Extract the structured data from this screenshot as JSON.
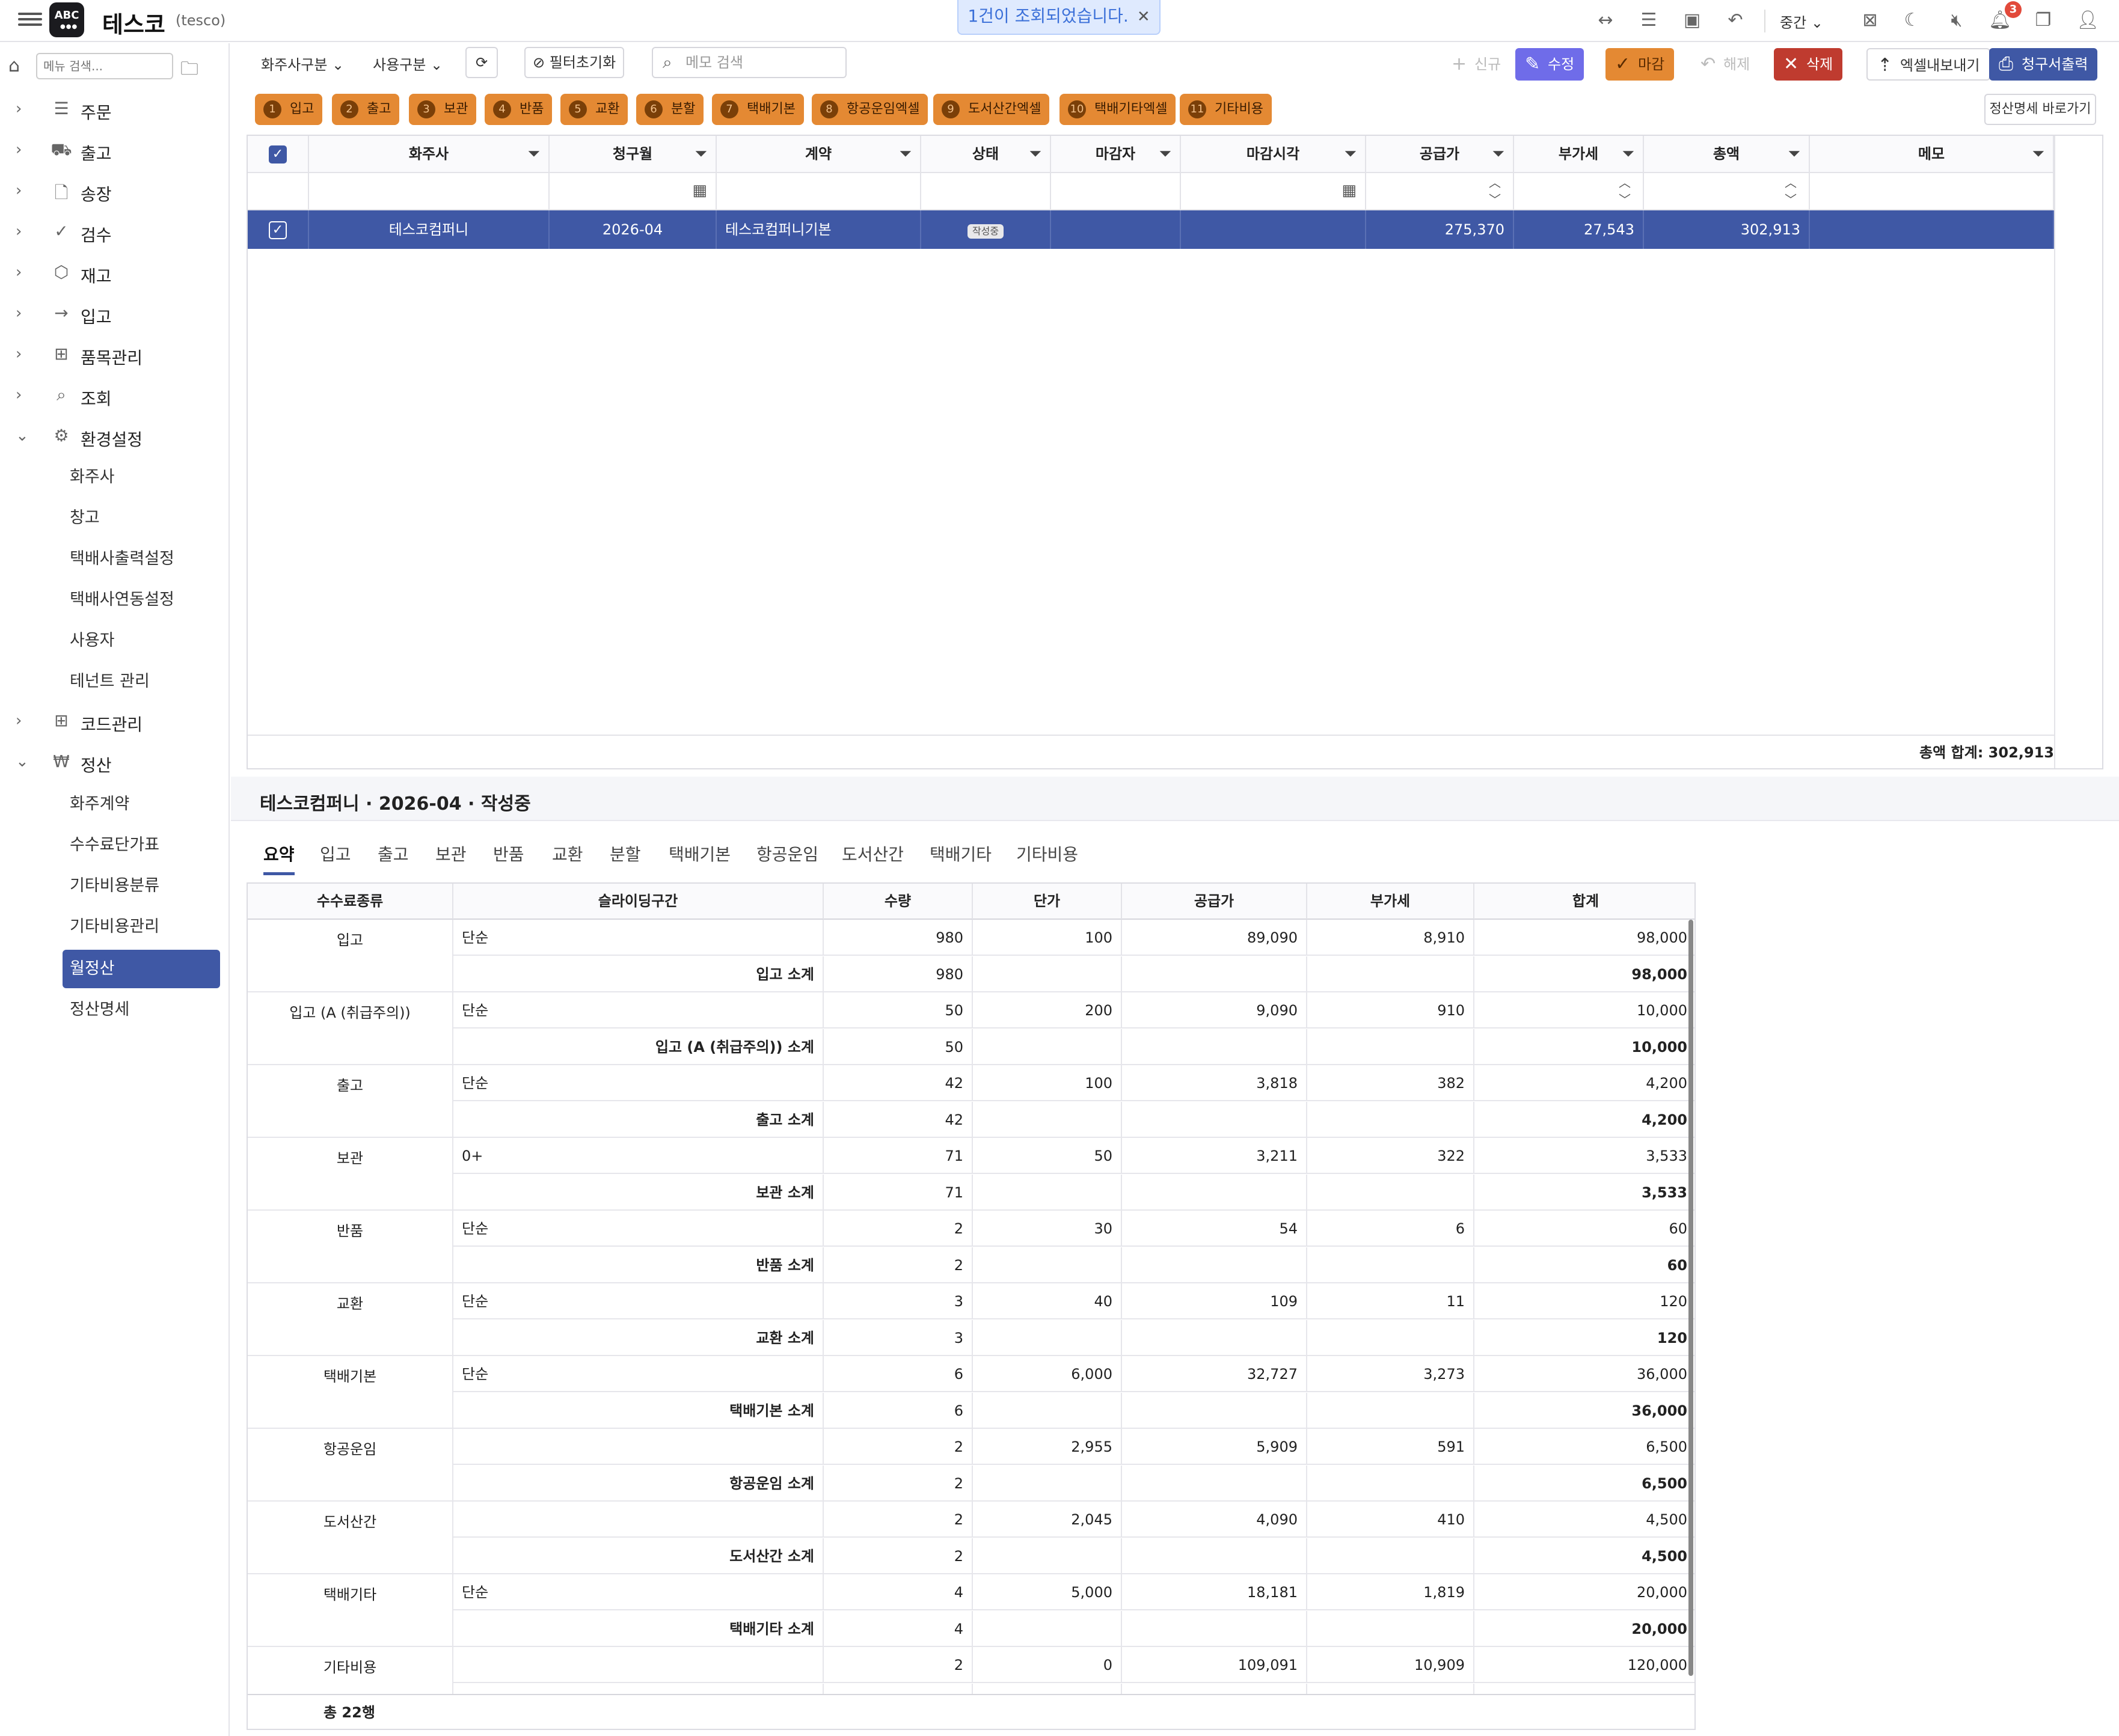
{
  "header": {
    "logo_text": "ABC",
    "app_title": "테스코",
    "app_sub": "(tesco)",
    "toast": "1건이 조회되었습니다.",
    "zoom": "중간",
    "notification_count": "3"
  },
  "sidebar": {
    "search_placeholder": "메뉴 검색...",
    "menu": [
      {
        "label": "주문",
        "icon": "list-icon"
      },
      {
        "label": "출고",
        "icon": "truck-icon"
      },
      {
        "label": "송장",
        "icon": "document-icon"
      },
      {
        "label": "검수",
        "icon": "check-icon"
      },
      {
        "label": "재고",
        "icon": "box-icon"
      },
      {
        "label": "입고",
        "icon": "arrow-right-icon"
      },
      {
        "label": "품목관리",
        "icon": "gift-icon"
      },
      {
        "label": "조회",
        "icon": "search-icon"
      },
      {
        "label": "환경설정",
        "icon": "gear-icon"
      }
    ],
    "settings_sub": [
      "화주사",
      "창고",
      "택배사출력설정",
      "택배사연동설정",
      "사용자",
      "테넌트 관리"
    ],
    "code_menu": {
      "label": "코드관리",
      "icon": "plus-square-icon"
    },
    "settle_menu": {
      "label": "정산",
      "icon": "won-icon"
    },
    "settle_sub": [
      "화주계약",
      "수수료단가표",
      "기타비용분류",
      "기타비용관리",
      "월정산",
      "정산명세"
    ]
  },
  "toolbar": {
    "shipper_type": "화주사구분",
    "use_type": "사용구분",
    "filter_reset": "필터초기화",
    "memo_search_placeholder": "메모 검색",
    "new": "신규",
    "edit": "수정",
    "close": "마감",
    "release": "해제",
    "delete": "삭제",
    "excel_export": "엑셀내보내기",
    "print_invoice": "청구서출력"
  },
  "chips": [
    {
      "num": "1",
      "label": "입고"
    },
    {
      "num": "2",
      "label": "출고"
    },
    {
      "num": "3",
      "label": "보관"
    },
    {
      "num": "4",
      "label": "반품"
    },
    {
      "num": "5",
      "label": "교환"
    },
    {
      "num": "6",
      "label": "분할"
    },
    {
      "num": "7",
      "label": "택배기본"
    },
    {
      "num": "8",
      "label": "항공운임엑셀"
    },
    {
      "num": "9",
      "label": "도서산간엑셀"
    },
    {
      "num": "10",
      "label": "택배기타엑셀"
    },
    {
      "num": "11",
      "label": "기타비용"
    }
  ],
  "goto_statement": "정산명세 바로가기",
  "grid": {
    "headers": [
      "화주사",
      "청구월",
      "계약",
      "상태",
      "마감자",
      "마감시각",
      "공급가",
      "부가세",
      "총액",
      "메모"
    ],
    "row": {
      "shipper": "테스코컴퍼니",
      "month": "2026-04",
      "contract": "테스코컴퍼니기본",
      "status": "작성중",
      "closer": "",
      "close_time": "",
      "supply": "275,370",
      "vat": "27,543",
      "total": "302,913",
      "memo": ""
    },
    "footer": "총액 합계: 302,913"
  },
  "detail": {
    "title": "테스코컴퍼니 · 2026-04 · 작성중",
    "tabs": [
      "요약",
      "입고",
      "출고",
      "보관",
      "반품",
      "교환",
      "분할",
      "택배기본",
      "항공운임",
      "도서산간",
      "택배기타",
      "기타비용"
    ],
    "headers": [
      "수수료종류",
      "슬라이딩구간",
      "수량",
      "단가",
      "공급가",
      "부가세",
      "합계"
    ],
    "groups": [
      {
        "kind": "입고",
        "tier": "단순",
        "qty": "980",
        "price": "100",
        "supply": "89,090",
        "vat": "8,910",
        "sum": "98,000",
        "sub_label": "입고 소계",
        "sub_qty": "980",
        "sub_sum": "98,000"
      },
      {
        "kind": "입고 (A (취급주의))",
        "tier": "단순",
        "qty": "50",
        "price": "200",
        "supply": "9,090",
        "vat": "910",
        "sum": "10,000",
        "sub_label": "입고 (A (취급주의)) 소계",
        "sub_qty": "50",
        "sub_sum": "10,000"
      },
      {
        "kind": "출고",
        "tier": "단순",
        "qty": "42",
        "price": "100",
        "supply": "3,818",
        "vat": "382",
        "sum": "4,200",
        "sub_label": "출고 소계",
        "sub_qty": "42",
        "sub_sum": "4,200"
      },
      {
        "kind": "보관",
        "tier": "0+",
        "qty": "71",
        "price": "50",
        "supply": "3,211",
        "vat": "322",
        "sum": "3,533",
        "sub_label": "보관 소계",
        "sub_qty": "71",
        "sub_sum": "3,533"
      },
      {
        "kind": "반품",
        "tier": "단순",
        "qty": "2",
        "price": "30",
        "supply": "54",
        "vat": "6",
        "sum": "60",
        "sub_label": "반품 소계",
        "sub_qty": "2",
        "sub_sum": "60"
      },
      {
        "kind": "교환",
        "tier": "단순",
        "qty": "3",
        "price": "40",
        "supply": "109",
        "vat": "11",
        "sum": "120",
        "sub_label": "교환 소계",
        "sub_qty": "3",
        "sub_sum": "120"
      },
      {
        "kind": "택배기본",
        "tier": "단순",
        "qty": "6",
        "price": "6,000",
        "supply": "32,727",
        "vat": "3,273",
        "sum": "36,000",
        "sub_label": "택배기본 소계",
        "sub_qty": "6",
        "sub_sum": "36,000"
      },
      {
        "kind": "항공운임",
        "tier": "",
        "qty": "2",
        "price": "2,955",
        "supply": "5,909",
        "vat": "591",
        "sum": "6,500",
        "sub_label": "항공운임 소계",
        "sub_qty": "2",
        "sub_sum": "6,500"
      },
      {
        "kind": "도서산간",
        "tier": "",
        "qty": "2",
        "price": "2,045",
        "supply": "4,090",
        "vat": "410",
        "sum": "4,500",
        "sub_label": "도서산간 소계",
        "sub_qty": "2",
        "sub_sum": "4,500"
      },
      {
        "kind": "택배기타",
        "tier": "단순",
        "qty": "4",
        "price": "5,000",
        "supply": "18,181",
        "vat": "1,819",
        "sum": "20,000",
        "sub_label": "택배기타 소계",
        "sub_qty": "4",
        "sub_sum": "20,000"
      },
      {
        "kind": "기타비용",
        "tier": "",
        "qty": "2",
        "price": "0",
        "supply": "109,091",
        "vat": "10,909",
        "sum": "120,000",
        "sub_label": "",
        "sub_qty": "",
        "sub_sum": ""
      }
    ],
    "footer": "총 22행"
  },
  "colors": {
    "primary": "#3f58a5",
    "edit": "#6f6ce9",
    "close": "#e48933",
    "delete": "#bf3b2f",
    "toast_bg": "#dfeafe"
  }
}
